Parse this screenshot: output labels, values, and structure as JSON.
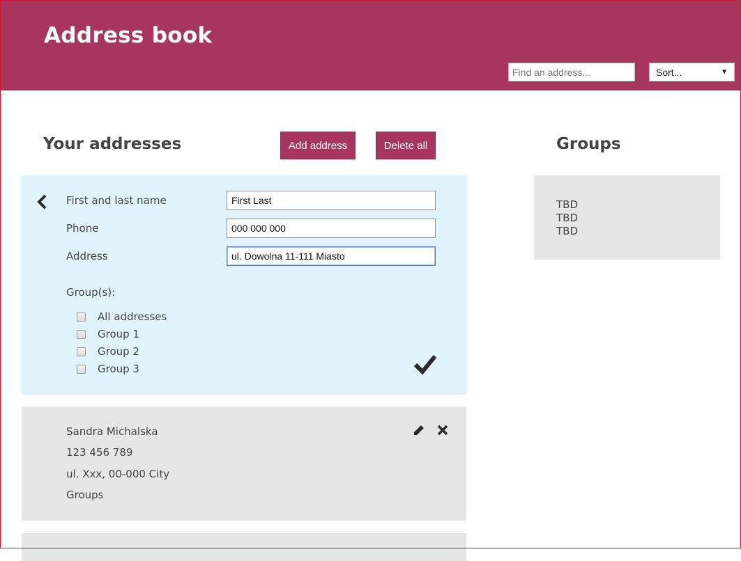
{
  "header": {
    "title": "Address book",
    "search_placeholder": "Find an address...",
    "sort_value": "Sort..."
  },
  "addresses": {
    "title": "Your addresses",
    "add_button": "Add address",
    "delete_all_button": "Delete all"
  },
  "edit_form": {
    "name_label": "First and last name",
    "name_value": "First Last",
    "phone_label": "Phone",
    "phone_value": "000 000 000",
    "address_label": "Address",
    "address_value": "ul. Dowolna 11-111 Miasto",
    "groups_label": "Group(s):",
    "group_options": [
      "All addresses",
      "Group 1",
      "Group 2",
      "Group 3"
    ]
  },
  "contacts": [
    {
      "name": "Sandra Michalska",
      "phone": "123 456 789",
      "address": "ul. Xxx, 00-000 City",
      "groups": "Groups"
    }
  ],
  "groups_panel": {
    "title": "Groups",
    "items": [
      "TBD",
      "TBD",
      "TBD"
    ]
  },
  "colors": {
    "brand": "#a8355e",
    "edit_card_bg": "#e1f3fc",
    "card_bg": "#e6e6e6"
  }
}
